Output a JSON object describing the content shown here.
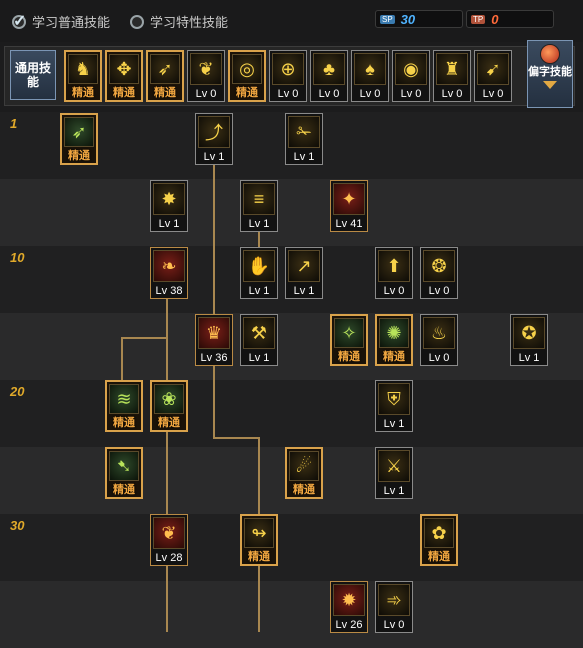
{
  "top": {
    "radio_normal": "学习普通技能",
    "radio_special": "学习特性技能",
    "sp_label": "SP",
    "sp_value": "30",
    "tp_label": "TP",
    "tp_value": "0"
  },
  "common_panel": {
    "label": "通用技能",
    "side_button": "偏字技能",
    "skills": [
      {
        "label": "精通",
        "icon": "sit-icon",
        "style": "master",
        "glyph": "♞"
      },
      {
        "label": "精通",
        "icon": "lotus-icon",
        "style": "master",
        "glyph": "✥"
      },
      {
        "label": "精通",
        "icon": "kick-icon",
        "style": "master",
        "glyph": "➶"
      },
      {
        "label": "Lv 0",
        "icon": "wings-icon",
        "style": "normal",
        "glyph": "❦"
      },
      {
        "label": "精通",
        "icon": "target-icon",
        "style": "master",
        "glyph": "◎"
      },
      {
        "label": "Lv 0",
        "icon": "crosshair-icon",
        "style": "normal",
        "glyph": "⊕"
      },
      {
        "label": "Lv 0",
        "icon": "mushroom-icon",
        "style": "normal",
        "glyph": "♣"
      },
      {
        "label": "Lv 0",
        "icon": "mushroom-boost-icon",
        "style": "normal",
        "glyph": "♠"
      },
      {
        "label": "Lv 0",
        "icon": "eye-icon",
        "style": "normal",
        "glyph": "◉"
      },
      {
        "label": "Lv 0",
        "icon": "warrior-icon",
        "style": "normal",
        "glyph": "♜"
      },
      {
        "label": "Lv 0",
        "icon": "sprint-icon",
        "style": "normal",
        "glyph": "➹"
      }
    ]
  },
  "level_markers": [
    "1",
    "10",
    "20",
    "30"
  ],
  "tree": [
    {
      "label": "精通",
      "style": "master",
      "color": "green",
      "glyph": "➶",
      "icon": "wind-kick-icon"
    },
    {
      "label": "Lv 1",
      "style": "normal",
      "color": "gold",
      "glyph": "⤴",
      "icon": "uppercut-icon"
    },
    {
      "label": "Lv 1",
      "style": "normal",
      "color": "gold",
      "glyph": "✁",
      "icon": "scissor-kick-icon"
    },
    {
      "label": "Lv 1",
      "style": "normal",
      "color": "gold",
      "glyph": "✸",
      "icon": "burst-icon"
    },
    {
      "label": "Lv 1",
      "style": "normal",
      "color": "gold",
      "glyph": "≡",
      "icon": "dash-icon"
    },
    {
      "label": "Lv 41",
      "style": "ult",
      "color": "red",
      "glyph": "✦",
      "icon": "gun-blast-icon"
    },
    {
      "label": "Lv 38",
      "style": "ult",
      "color": "red",
      "glyph": "❧",
      "icon": "flame-claw-icon"
    },
    {
      "label": "Lv 1",
      "style": "normal",
      "color": "gold",
      "glyph": "✋",
      "icon": "palm-strike-icon"
    },
    {
      "label": "Lv 1",
      "style": "normal",
      "color": "gold",
      "glyph": "↗",
      "icon": "spear-icon"
    },
    {
      "label": "Lv 0",
      "style": "normal",
      "color": "gold",
      "glyph": "⬆",
      "icon": "rise-icon"
    },
    {
      "label": "Lv 0",
      "style": "normal",
      "color": "gold",
      "glyph": "❂",
      "icon": "beast-icon"
    },
    {
      "label": "Lv 36",
      "style": "ult",
      "color": "red",
      "glyph": "♛",
      "icon": "guardian-icon"
    },
    {
      "label": "Lv 1",
      "style": "normal",
      "color": "gold",
      "glyph": "⚒",
      "icon": "hammer-icon"
    },
    {
      "label": "精通",
      "style": "master",
      "color": "green",
      "glyph": "✧",
      "icon": "spirit-icon"
    },
    {
      "label": "精通",
      "style": "master",
      "color": "green",
      "glyph": "✺",
      "icon": "radiance-icon"
    },
    {
      "label": "Lv 0",
      "style": "normal",
      "color": "gold",
      "glyph": "♨",
      "icon": "steam-icon"
    },
    {
      "label": "Lv 1",
      "style": "normal",
      "color": "gold",
      "glyph": "✪",
      "icon": "bomb-icon"
    },
    {
      "label": "精通",
      "style": "master",
      "color": "green",
      "glyph": "≋",
      "icon": "whirlwind-icon"
    },
    {
      "label": "精通",
      "style": "master",
      "color": "green",
      "glyph": "❀",
      "icon": "leaf-icon"
    },
    {
      "label": "Lv 1",
      "style": "normal",
      "color": "gold",
      "glyph": "⛨",
      "icon": "shield-icon"
    },
    {
      "label": "精通",
      "style": "master",
      "color": "green",
      "glyph": "➷",
      "icon": "gale-icon"
    },
    {
      "label": "精通",
      "style": "master",
      "color": "gold",
      "glyph": "☄",
      "icon": "comet-icon"
    },
    {
      "label": "Lv 1",
      "style": "normal",
      "color": "gold",
      "glyph": "⚔",
      "icon": "assault-icon"
    },
    {
      "label": "Lv 28",
      "style": "ult",
      "color": "red",
      "glyph": "❦",
      "icon": "blade-storm-icon"
    },
    {
      "label": "精通",
      "style": "master",
      "color": "gold",
      "glyph": "↬",
      "icon": "hook-icon"
    },
    {
      "label": "精通",
      "style": "master",
      "color": "gold",
      "glyph": "✿",
      "icon": "bloom-icon"
    },
    {
      "label": "Lv 26",
      "style": "ult",
      "color": "red",
      "glyph": "✹",
      "icon": "explosion-icon"
    },
    {
      "label": "Lv 0",
      "style": "normal",
      "color": "gold",
      "glyph": "➾",
      "icon": "charge-icon"
    }
  ]
}
